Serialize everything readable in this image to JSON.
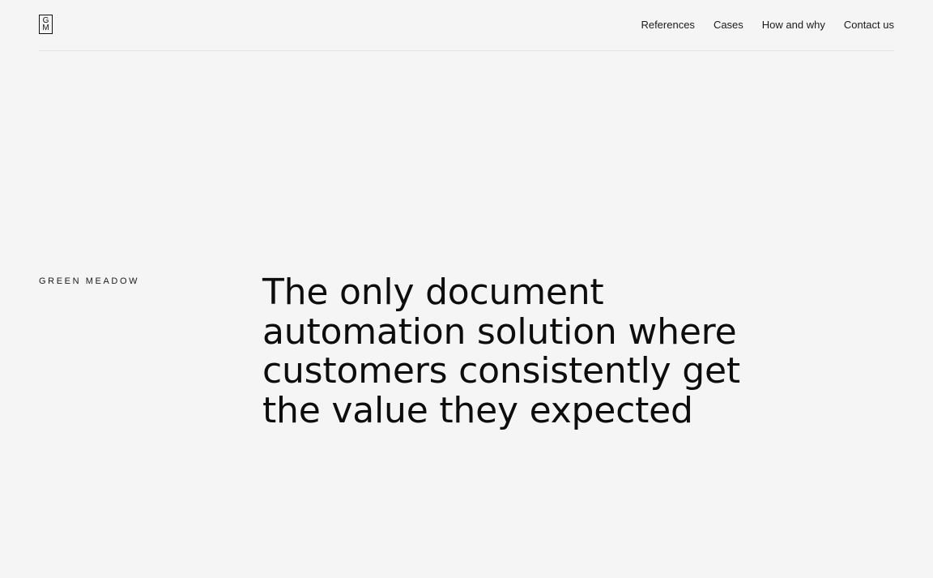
{
  "logo": {
    "top_letter": "G",
    "bottom_letter": "M"
  },
  "nav": {
    "items": [
      {
        "label": "References"
      },
      {
        "label": "Cases"
      },
      {
        "label": "How and why"
      },
      {
        "label": "Contact us"
      }
    ]
  },
  "hero": {
    "brand": "GREEN MEADOW",
    "headline_lines": [
      "The only document",
      "automation solution where",
      "customers consistently get",
      "the value they expected"
    ]
  },
  "colors": {
    "background": "#f5f5f5",
    "text": "#0d0d0d",
    "divider": "#e2e2e2"
  }
}
